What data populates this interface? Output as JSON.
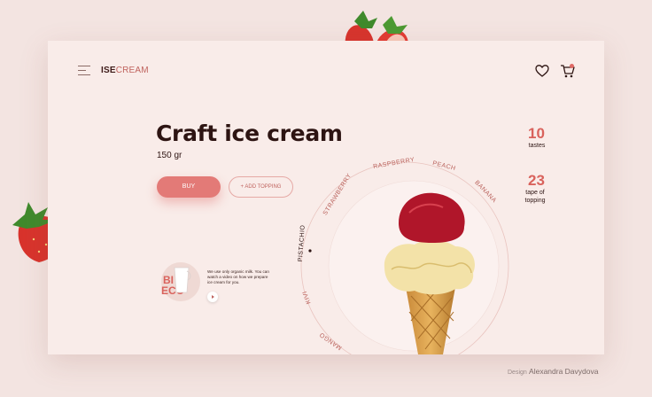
{
  "header": {
    "logo_bold": "ISE",
    "logo_rest": "CREAM",
    "menu_icon": "hamburger-icon",
    "favorite_icon": "heart-icon",
    "cart_icon": "cart-icon"
  },
  "product": {
    "title": "Craft ice cream",
    "weight": "150 gr",
    "buy_label": "BUY",
    "topping_label": "+ ADD TOPPING"
  },
  "stats": [
    {
      "value": "10",
      "label": "tastes"
    },
    {
      "value": "23",
      "label": "tape of topping"
    }
  ],
  "promo": {
    "badge_line1": "BI",
    "badge_line2": "ECO",
    "description": "We use only organic milk. You can watch a video on how we prepare ice cream for you.",
    "play_icon": "play-icon"
  },
  "flavors": {
    "items": [
      "STRAWBERRY",
      "RASPBERRY",
      "PEACH",
      "BANANA",
      "PISTACHIO",
      "KIVI",
      "MANGO"
    ],
    "selected": "PISTACHIO"
  },
  "credit": {
    "prefix": "Design",
    "name": "Alexandra Davydova"
  },
  "colors": {
    "accent": "#e37a77",
    "dark": "#2d1412",
    "background": "#f3e4e1",
    "card": "#f9ece9"
  }
}
